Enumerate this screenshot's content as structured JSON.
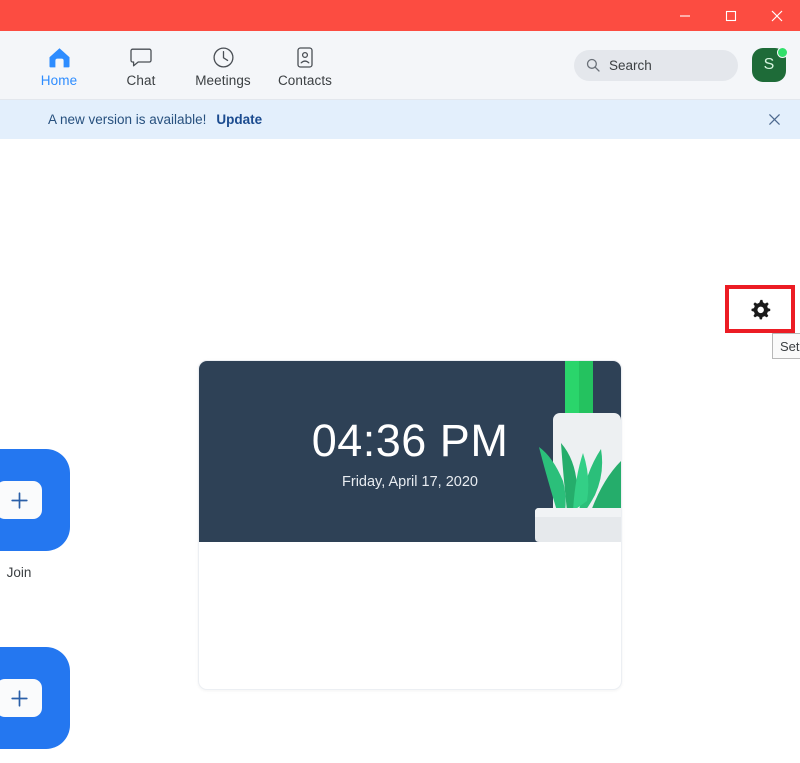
{
  "window": {
    "accent_color": "#fc4c41",
    "controls": [
      {
        "name": "minimize",
        "glyph": "minimize-icon"
      },
      {
        "name": "maximize",
        "glyph": "maximize-icon"
      },
      {
        "name": "close",
        "glyph": "close-icon"
      }
    ]
  },
  "nav": {
    "tabs": [
      {
        "label": "Home",
        "icon": "home-icon",
        "active": true
      },
      {
        "label": "Chat",
        "icon": "chat-bubble-icon",
        "active": false
      },
      {
        "label": "Meetings",
        "icon": "clock-icon",
        "active": false
      },
      {
        "label": "Contacts",
        "icon": "contact-card-icon",
        "active": false
      }
    ],
    "search": {
      "placeholder": "Search",
      "icon": "search-icon"
    },
    "avatar": {
      "initial": "S",
      "background": "#1e6b38",
      "status": "available",
      "status_color": "#31e06a"
    }
  },
  "banner": {
    "message": "A new version is available!",
    "action_label": "Update",
    "close_icon": "close-icon",
    "background": "#e3effc"
  },
  "settings": {
    "icon": "gear-icon",
    "tooltip": "Set",
    "highlight_color": "#ec1c24"
  },
  "clock_card": {
    "time": "04:36 PM",
    "date": "Friday, April 17, 2020",
    "background": "#2e4156",
    "illustration": "potted-plant-illustration"
  },
  "actions": [
    {
      "label": "Join",
      "icon": "plus-icon",
      "color": "#2477f0"
    },
    {
      "label": "",
      "icon": "plus-icon",
      "color": "#2477f0"
    }
  ]
}
